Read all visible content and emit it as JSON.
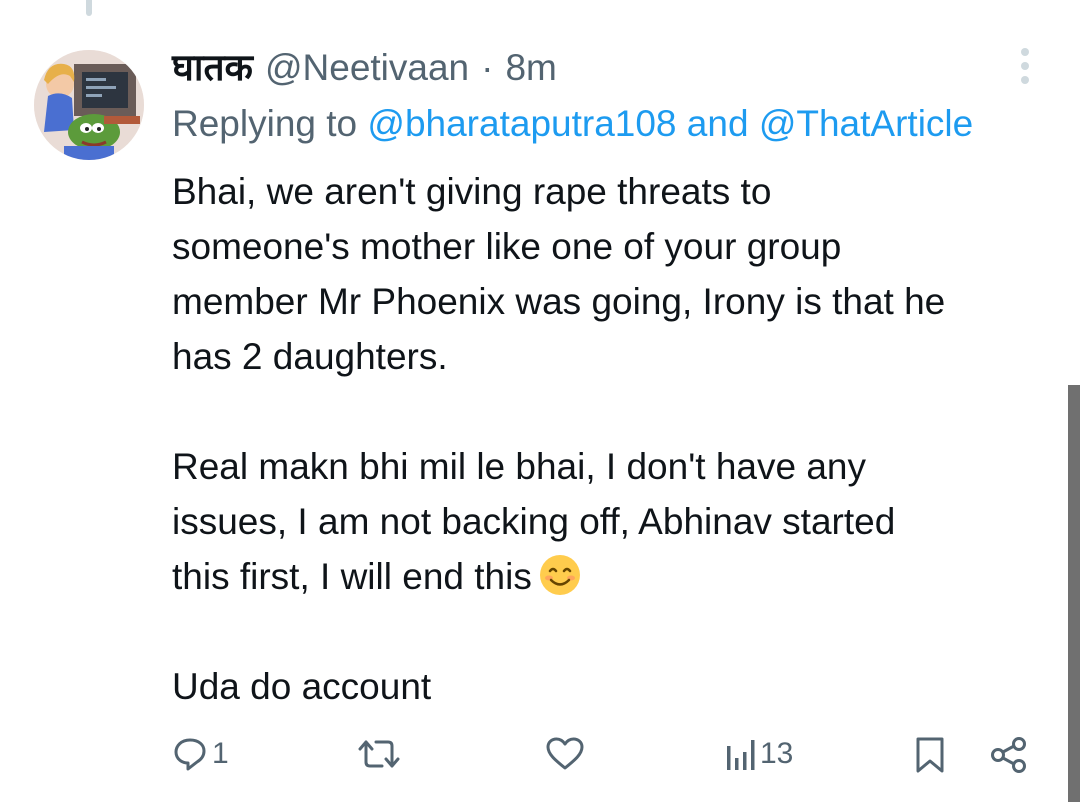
{
  "tweet": {
    "display_name": "घातक",
    "handle": "@Neetivaan",
    "separator": "·",
    "time": "8m",
    "replying_prefix": "Replying to",
    "reply_mention_1": "@bharataputra108",
    "reply_conjunction": "and",
    "reply_mention_2": "@ThatArticle",
    "body": {
      "line1": "Bhai, we aren't giving rape threats to",
      "line2": "someone's mother like one of your group",
      "line3": "member Mr Phoenix was going, Irony is that he",
      "line4": "has 2 daughters.",
      "line5": "Real makn bhi mil le bhai, I don't have any",
      "line6": "issues, I am not backing off, Abhinav started",
      "line7": "this first, I will end this",
      "line8": "Uda do account"
    },
    "emoji_icon": "smiling-face-emoji"
  },
  "actions": {
    "reply_count": "1",
    "views_count": "13"
  },
  "colors": {
    "text": "#0f1419",
    "secondary": "#536471",
    "link": "#1d9bf0"
  }
}
